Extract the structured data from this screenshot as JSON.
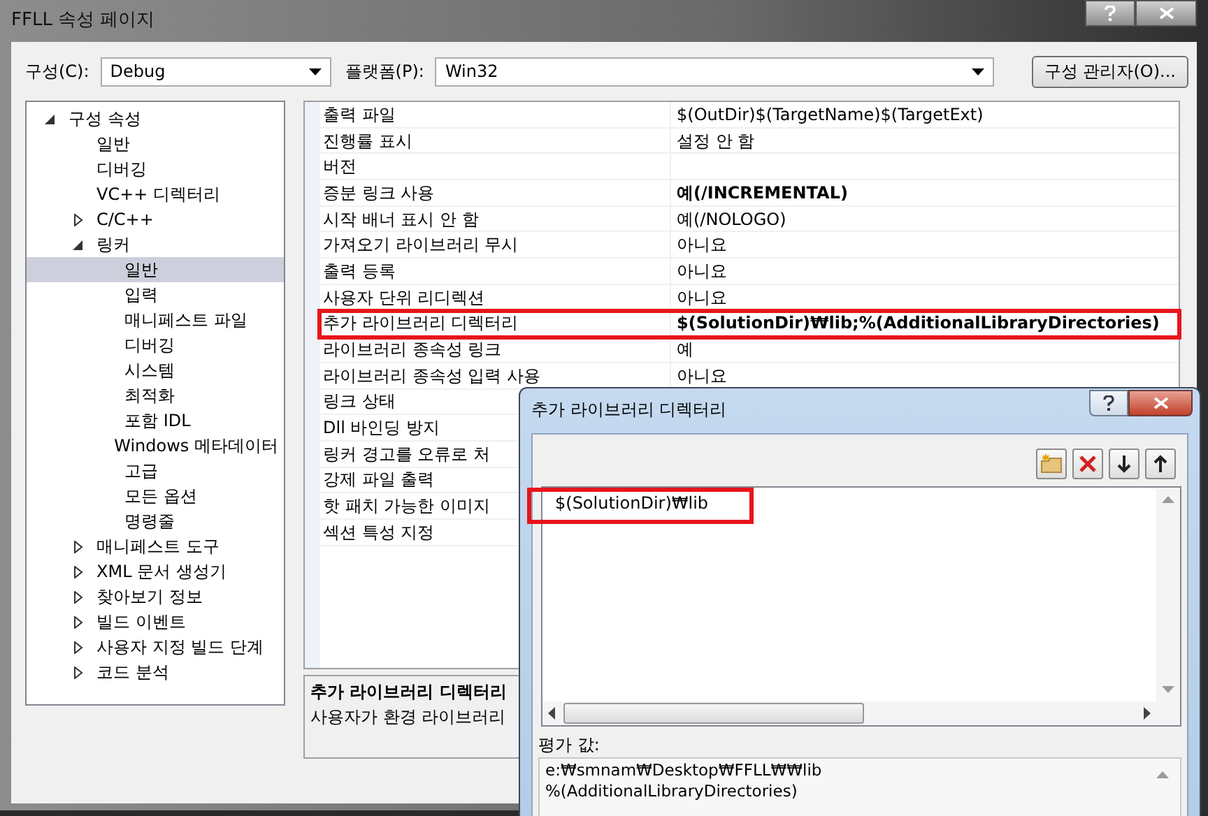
{
  "window": {
    "title": "FFLL 속성 페이지"
  },
  "toolbar": {
    "configuration": {
      "label": "구성(C):",
      "value": "Debug"
    },
    "platform": {
      "label": "플랫폼(P):",
      "value": "Win32"
    },
    "manager_button": "구성 관리자(O)..."
  },
  "tree": [
    {
      "label": "구성 속성",
      "expanded": true,
      "selected": false,
      "children": [
        {
          "label": "일반",
          "selected": false
        },
        {
          "label": "디버깅",
          "selected": false
        },
        {
          "label": "VC++ 디렉터리",
          "selected": false
        },
        {
          "label": "C/C++",
          "expanded": false,
          "selected": false
        },
        {
          "label": "링커",
          "expanded": true,
          "selected": false,
          "children": [
            {
              "label": "일반",
              "selected": true
            },
            {
              "label": "입력",
              "selected": false
            },
            {
              "label": "매니페스트 파일",
              "selected": false
            },
            {
              "label": "디버깅",
              "selected": false
            },
            {
              "label": "시스템",
              "selected": false
            },
            {
              "label": "최적화",
              "selected": false
            },
            {
              "label": "포함 IDL",
              "selected": false
            },
            {
              "label": "Windows 메타데이터",
              "selected": false
            },
            {
              "label": "고급",
              "selected": false
            },
            {
              "label": "모든 옵션",
              "selected": false
            },
            {
              "label": "명령줄",
              "selected": false
            }
          ]
        },
        {
          "label": "매니페스트 도구",
          "expanded": false,
          "selected": false
        },
        {
          "label": "XML 문서 생성기",
          "expanded": false,
          "selected": false
        },
        {
          "label": "찾아보기 정보",
          "expanded": false,
          "selected": false
        },
        {
          "label": "빌드 이벤트",
          "expanded": false,
          "selected": false
        },
        {
          "label": "사용자 지정 빌드 단계",
          "expanded": false,
          "selected": false
        },
        {
          "label": "코드 분석",
          "expanded": false,
          "selected": false
        }
      ]
    }
  ],
  "properties": [
    {
      "name": "출력 파일",
      "value": "$(OutDir)$(TargetName)$(TargetExt)",
      "bold": false,
      "highlighted": false
    },
    {
      "name": "진행률 표시",
      "value": "설정 안 함",
      "bold": false,
      "highlighted": false
    },
    {
      "name": "버전",
      "highlighted": false
    },
    {
      "name": "증분 링크 사용",
      "value": "예(/INCREMENTAL)",
      "bold": true,
      "highlighted": false
    },
    {
      "name": "시작 배너 표시 안 함",
      "value": "예(/NOLOGO)",
      "bold": false,
      "highlighted": false
    },
    {
      "name": "가져오기 라이브러리 무시",
      "value": "아니요",
      "bold": false,
      "highlighted": false
    },
    {
      "name": "출력 등록",
      "value": "아니요",
      "bold": false,
      "highlighted": false
    },
    {
      "name": "사용자 단위 리디렉션",
      "value": "아니요",
      "bold": false,
      "highlighted": false
    },
    {
      "name": "추가 라이브러리 디렉터리",
      "value": "$(SolutionDir)₩lib;%(AdditionalLibraryDirectories)",
      "bold": true,
      "highlighted": true
    },
    {
      "name": "라이브러리 종속성 링크",
      "value": "예",
      "bold": false,
      "highlighted": false
    },
    {
      "name": "라이브러리 종속성 입력 사용",
      "value": "아니요",
      "bold": false,
      "highlighted": false
    },
    {
      "name": "링크 상태",
      "highlighted": false
    },
    {
      "name": "Dll 바인딩 방지",
      "highlighted": false
    },
    {
      "name": "링커 경고를 오류로 처",
      "highlighted": false
    },
    {
      "name": "강제 파일 출력",
      "highlighted": false
    },
    {
      "name": "핫 패치 가능한 이미지",
      "highlighted": false
    },
    {
      "name": "섹션 특성 지정",
      "highlighted": false
    }
  ],
  "description": {
    "title": "추가 라이브러리 디렉터리",
    "text": "사용자가 환경 라이브러리"
  },
  "dialog": {
    "title": "추가 라이브러리 디렉터리",
    "list": [
      {
        "text": "$(SolutionDir)₩lib",
        "highlighted": true
      }
    ],
    "evaluated_label": "평가 값:",
    "evaluated_lines": [
      "e:₩smnam₩Desktop₩FFLL₩₩lib",
      "%(AdditionalLibraryDirectories)"
    ]
  }
}
